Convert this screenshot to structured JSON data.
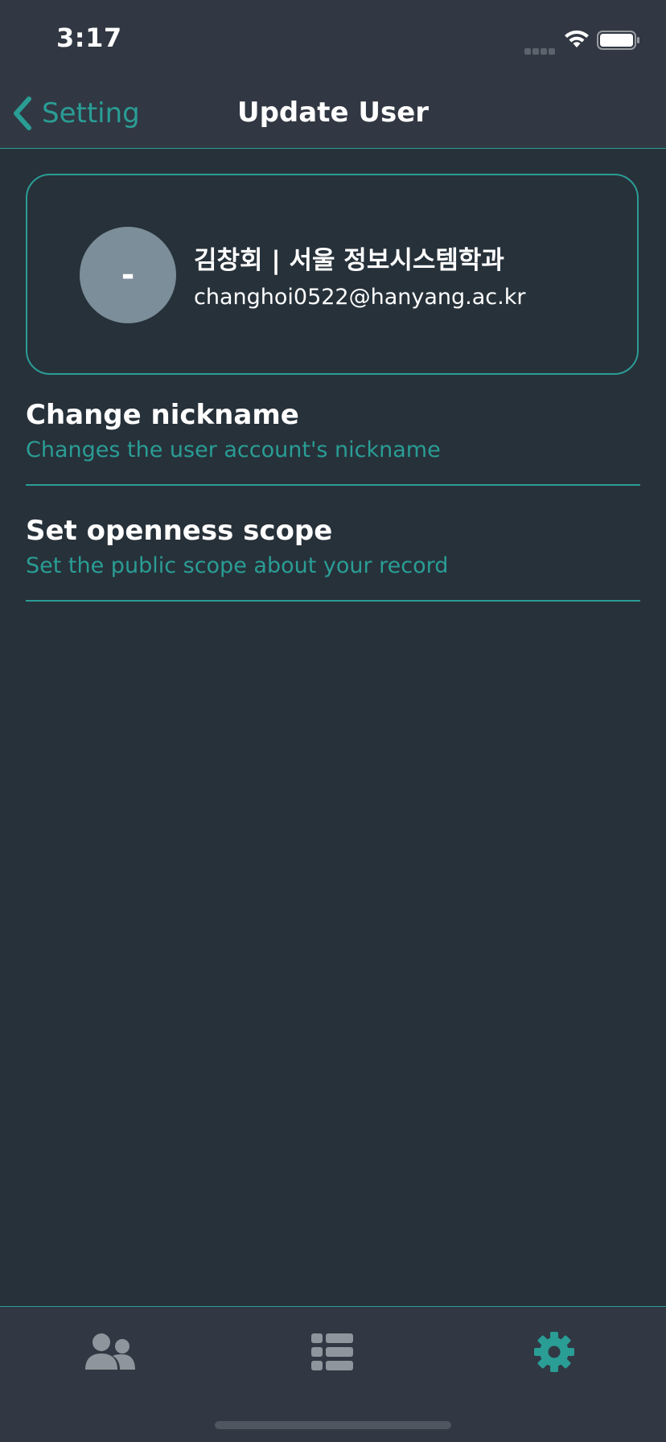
{
  "status_bar": {
    "time": "3:17"
  },
  "nav": {
    "back_label": "Setting",
    "title": "Update User"
  },
  "profile": {
    "avatar_text": "-",
    "name": "김창회 | 서울 정보시스템학과",
    "email": "changhoi0522@hanyang.ac.kr"
  },
  "settings": [
    {
      "title": "Change nickname",
      "subtitle": "Changes the user account's nickname"
    },
    {
      "title": "Set openness scope",
      "subtitle": "Set the public scope about your record"
    }
  ],
  "tab_bar": {
    "tabs": [
      {
        "icon": "users-icon",
        "active": false
      },
      {
        "icon": "list-icon",
        "active": false
      },
      {
        "icon": "gear-icon",
        "active": true
      }
    ]
  },
  "colors": {
    "background": "#27313a",
    "bar_background": "#313843",
    "accent": "#2a9d95",
    "avatar": "#7b8e99",
    "inactive_icon": "#8e959c"
  }
}
